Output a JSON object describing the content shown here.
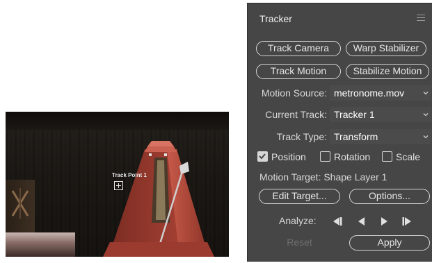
{
  "video": {
    "track_point_label": "Track Point 1"
  },
  "panel": {
    "title": "Tracker",
    "menu_icon": "hamburger-menu-icon",
    "buttons": {
      "track_camera": "Track Camera",
      "warp_stabilizer": "Warp Stabilizer",
      "track_motion": "Track Motion",
      "stabilize_motion": "Stabilize Motion",
      "edit_target": "Edit Target...",
      "options": "Options...",
      "reset": "Reset",
      "apply": "Apply"
    },
    "motion_source": {
      "label": "Motion Source:",
      "value": "metronome.mov"
    },
    "current_track": {
      "label": "Current Track:",
      "value": "Tracker 1"
    },
    "track_type": {
      "label": "Track Type:",
      "value": "Transform"
    },
    "checkboxes": {
      "position": {
        "label": "Position",
        "checked": true
      },
      "rotation": {
        "label": "Rotation",
        "checked": false
      },
      "scale": {
        "label": "Scale",
        "checked": false
      }
    },
    "motion_target": "Motion Target: Shape Layer 1",
    "analyze": {
      "label": "Analyze:",
      "icons": [
        "analyze-back-one-frame-icon",
        "analyze-backward-icon",
        "analyze-forward-icon",
        "analyze-forward-one-frame-icon"
      ]
    }
  },
  "colors": {
    "panel_bg": "#464646",
    "button_border": "#d6d6d6",
    "dropdown_bg": "#4b4b4b",
    "metronome_red": "#b5483b"
  }
}
